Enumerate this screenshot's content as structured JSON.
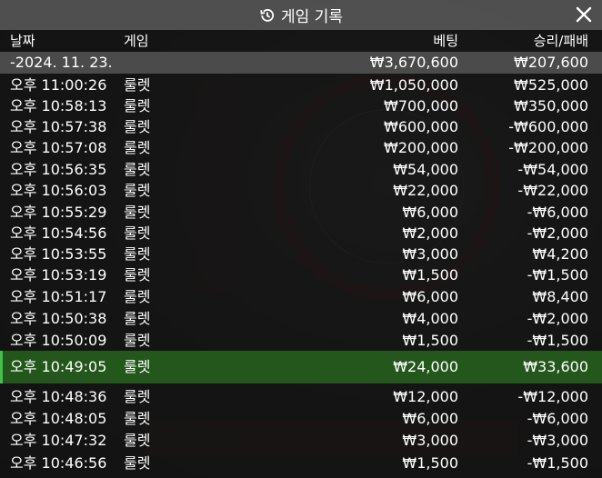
{
  "title": "게임 기록",
  "columns": {
    "date": "날짜",
    "game": "게임",
    "bet": "베팅",
    "result": "승리/패배"
  },
  "summary": {
    "date": "-2024. 11. 23.",
    "bet": "₩3,670,600",
    "result": "₩207,600"
  },
  "rows": [
    {
      "time": "오후 11:00:26",
      "game": "룰렛",
      "bet": "₩1,050,000",
      "result": "₩525,000"
    },
    {
      "time": "오후 10:58:13",
      "game": "룰렛",
      "bet": "₩700,000",
      "result": "₩350,000"
    },
    {
      "time": "오후 10:57:38",
      "game": "룰렛",
      "bet": "₩600,000",
      "result": "-₩600,000"
    },
    {
      "time": "오후 10:57:08",
      "game": "룰렛",
      "bet": "₩200,000",
      "result": "-₩200,000"
    },
    {
      "time": "오후 10:56:35",
      "game": "룰렛",
      "bet": "₩54,000",
      "result": "-₩54,000"
    },
    {
      "time": "오후 10:56:03",
      "game": "룰렛",
      "bet": "₩22,000",
      "result": "-₩22,000"
    },
    {
      "time": "오후 10:55:29",
      "game": "룰렛",
      "bet": "₩6,000",
      "result": "-₩6,000"
    },
    {
      "time": "오후 10:54:56",
      "game": "룰렛",
      "bet": "₩2,000",
      "result": "-₩2,000"
    },
    {
      "time": "오후 10:53:55",
      "game": "룰렛",
      "bet": "₩3,000",
      "result": "₩4,200"
    },
    {
      "time": "오후 10:53:19",
      "game": "룰렛",
      "bet": "₩1,500",
      "result": "-₩1,500"
    },
    {
      "time": "오후 10:51:17",
      "game": "룰렛",
      "bet": "₩6,000",
      "result": "₩8,400"
    },
    {
      "time": "오후 10:50:38",
      "game": "룰렛",
      "bet": "₩4,000",
      "result": "-₩2,000"
    },
    {
      "time": "오후 10:50:09",
      "game": "룰렛",
      "bet": "₩1,500",
      "result": "-₩1,500"
    },
    {
      "time": "오후 10:49:05",
      "game": "룰렛",
      "bet": "₩24,000",
      "result": "₩33,600"
    },
    {
      "time": "오후 10:48:36",
      "game": "룰렛",
      "bet": "₩12,000",
      "result": "-₩12,000"
    },
    {
      "time": "오후 10:48:05",
      "game": "룰렛",
      "bet": "₩6,000",
      "result": "-₩6,000"
    },
    {
      "time": "오후 10:47:32",
      "game": "룰렛",
      "bet": "₩3,000",
      "result": "-₩3,000"
    },
    {
      "time": "오후 10:46:56",
      "game": "룰렛",
      "bet": "₩1,500",
      "result": "-₩1,500"
    }
  ],
  "highlight_color": "#2e6e24",
  "icons": {
    "title": "history-icon",
    "close": "close-icon"
  }
}
